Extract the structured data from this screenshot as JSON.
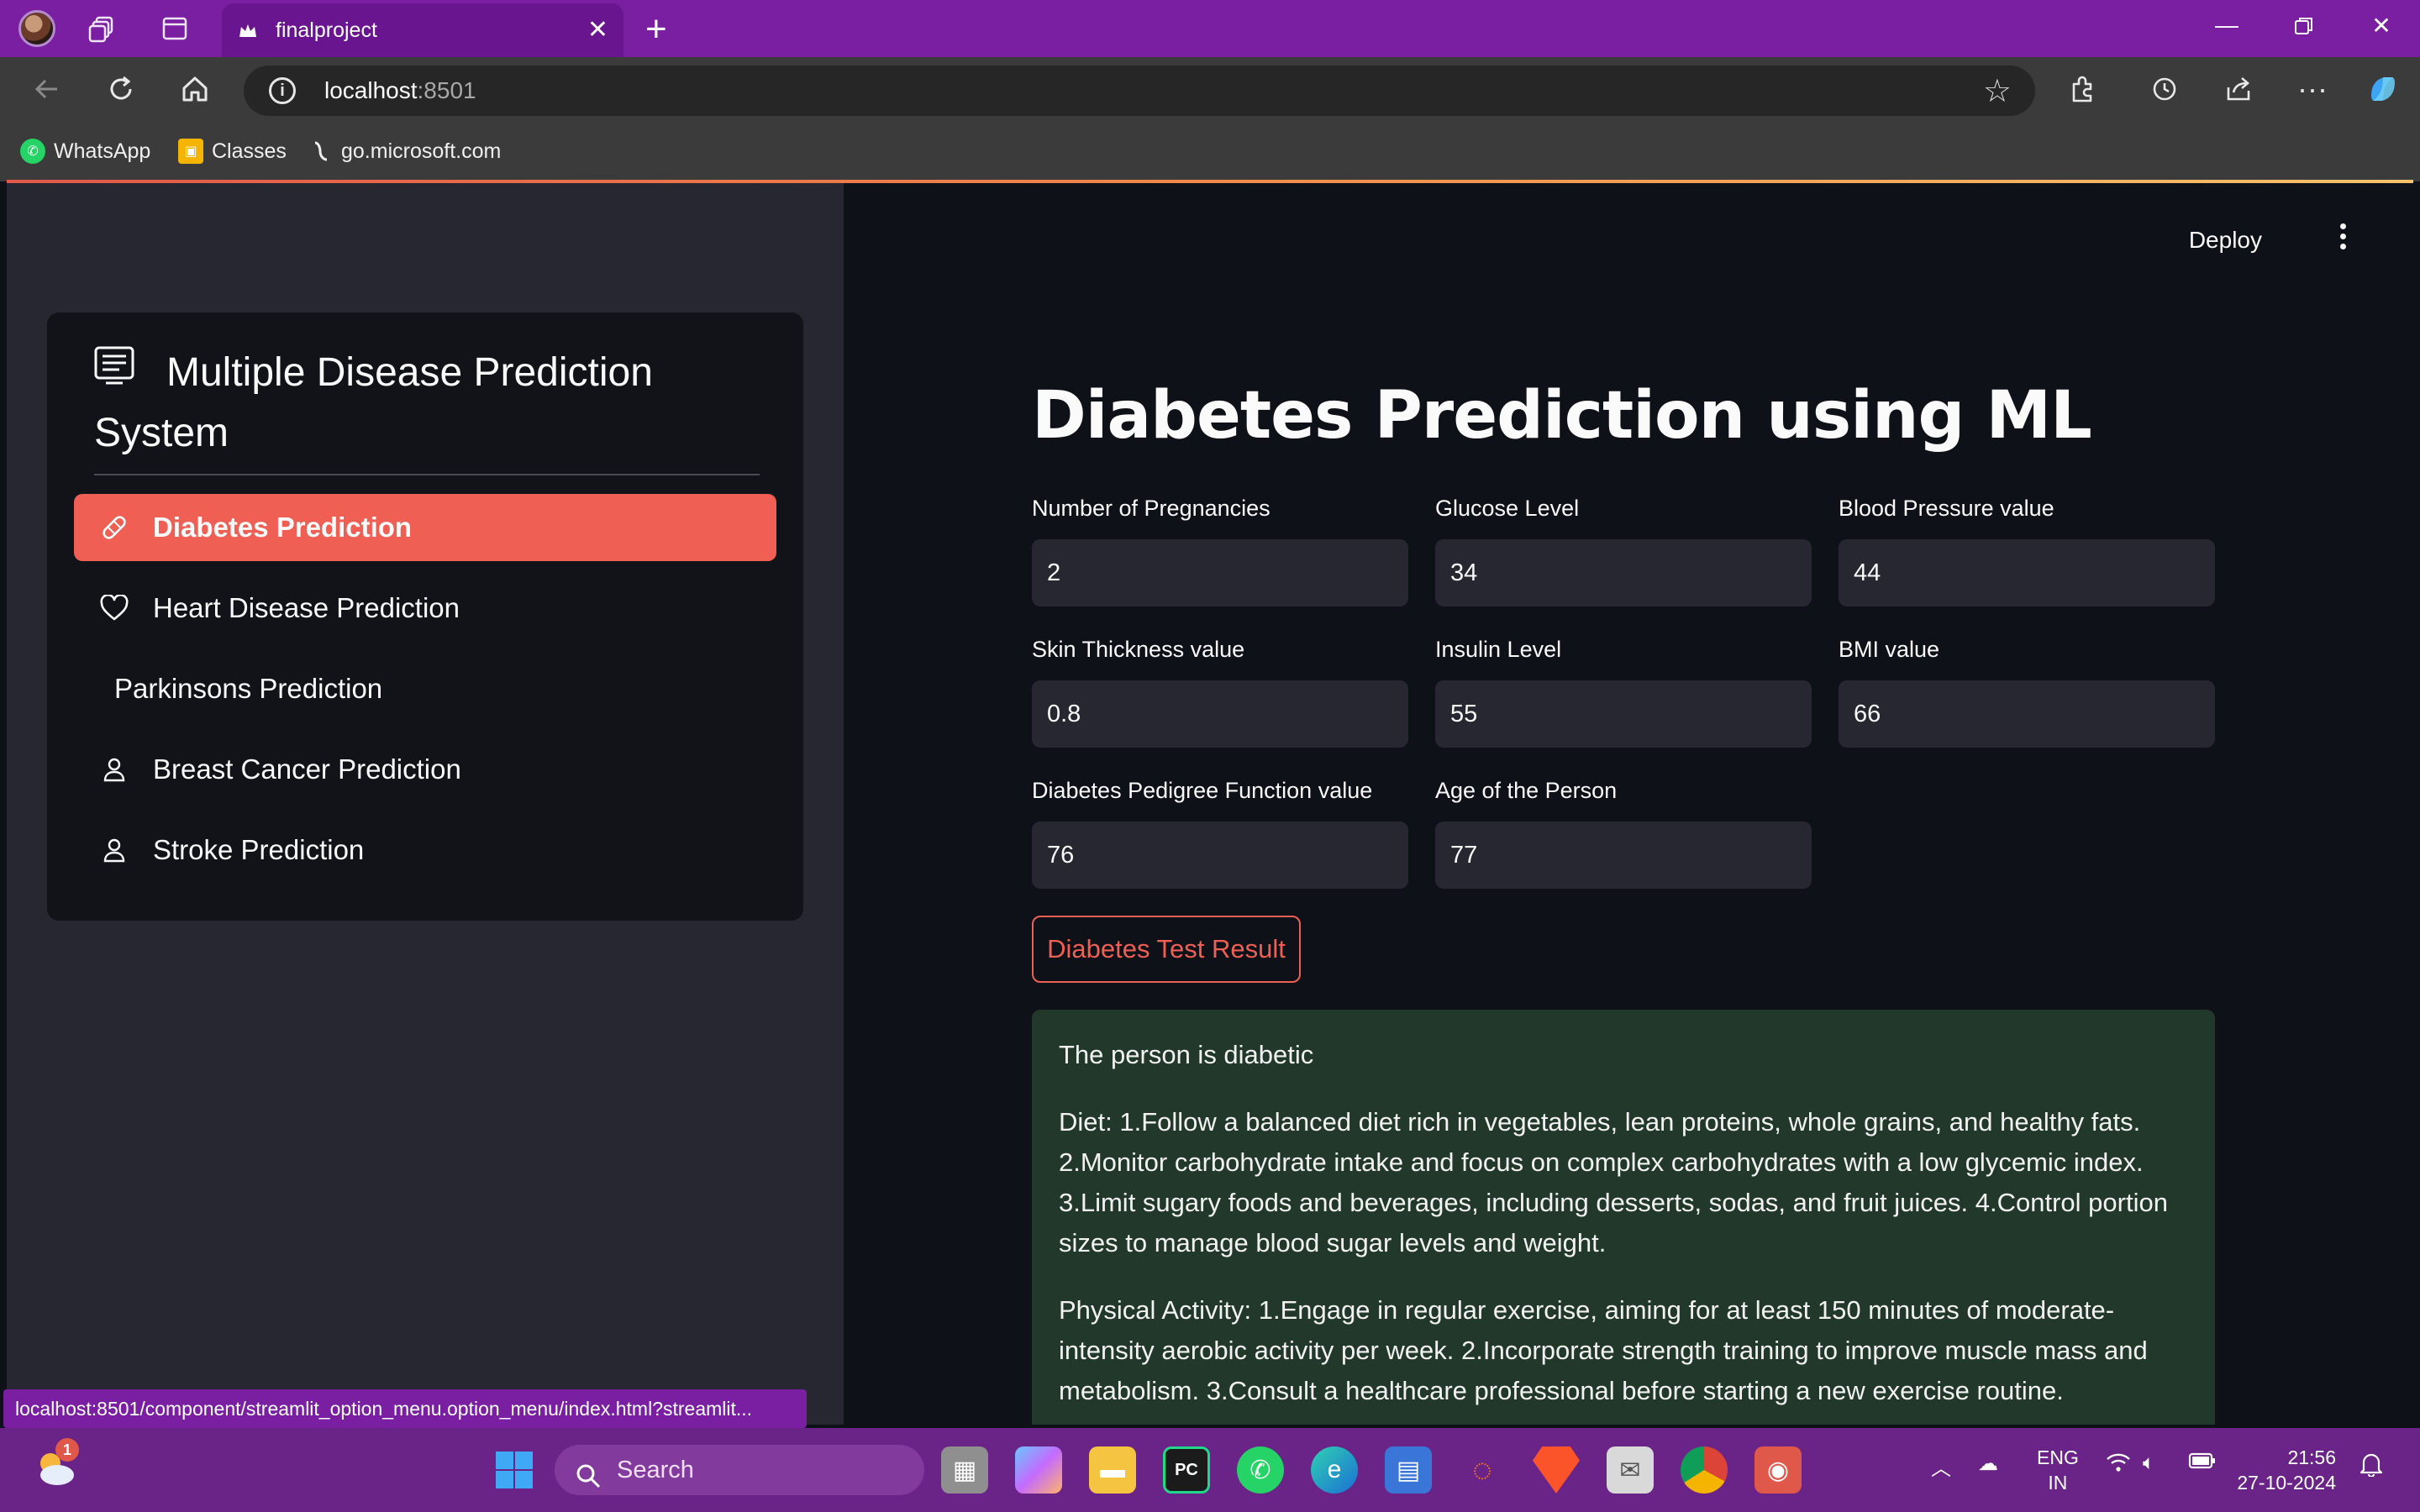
{
  "browser": {
    "tab_title": "finalproject",
    "url_host": "localhost",
    "url_port": ":8501",
    "bookmarks": [
      {
        "label": "WhatsApp"
      },
      {
        "label": "Classes"
      },
      {
        "label": "go.microsoft.com"
      }
    ],
    "status_url": "localhost:8501/component/streamlit_option_menu.option_menu/index.html?streamlit..."
  },
  "app": {
    "deploy_label": "Deploy",
    "sidebar": {
      "menu_title": "Multiple Disease Prediction System",
      "items": [
        {
          "label": "Diabetes Prediction",
          "icon": "bandaid-icon",
          "selected": true
        },
        {
          "label": "Heart Disease Prediction",
          "icon": "heart-icon",
          "selected": false
        },
        {
          "label": "Parkinsons Prediction",
          "icon": "",
          "selected": false
        },
        {
          "label": "Breast Cancer Prediction",
          "icon": "person-icon",
          "selected": false
        },
        {
          "label": "Stroke Prediction",
          "icon": "person-icon",
          "selected": false
        }
      ]
    },
    "main": {
      "title": "Diabetes Prediction using ML",
      "fields": [
        {
          "label": "Number of Pregnancies",
          "value": "2"
        },
        {
          "label": "Glucose Level",
          "value": "34"
        },
        {
          "label": "Blood Pressure value",
          "value": "44"
        },
        {
          "label": "Skin Thickness value",
          "value": "0.8"
        },
        {
          "label": "Insulin Level",
          "value": "55"
        },
        {
          "label": "BMI value",
          "value": "66"
        },
        {
          "label": "Diabetes Pedigree Function value",
          "value": "76"
        },
        {
          "label": "Age of the Person",
          "value": "77"
        }
      ],
      "result_button": "Diabetes Test Result",
      "result": {
        "headline": "The person is diabetic",
        "diet": "Diet: 1.Follow a balanced diet rich in vegetables, lean proteins, whole grains, and healthy fats. 2.Monitor carbohydrate intake and focus on complex carbohydrates with a low glycemic index. 3.Limit sugary foods and beverages, including desserts, sodas, and fruit juices. 4.Control portion sizes to manage blood sugar levels and weight.",
        "activity": "Physical Activity: 1.Engage in regular exercise, aiming for at least 150 minutes of moderate-intensity aerobic activity per week. 2.Incorporate strength training to improve muscle mass and metabolism. 3.Consult a healthcare professional before starting a new exercise routine."
      }
    }
  },
  "taskbar": {
    "weather_badge": "1",
    "search_label": "Search",
    "lang_line1": "ENG",
    "lang_line2": "IN",
    "time": "21:56",
    "date": "27-10-2024"
  },
  "colors": {
    "accent": "#ef5f54",
    "titlebar": "#7a1fa2",
    "sidebar_bg": "#262730",
    "main_bg": "#0e1117",
    "result_bg": "#22382a"
  }
}
